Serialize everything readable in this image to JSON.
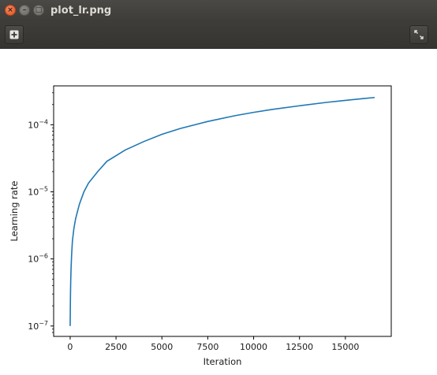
{
  "window": {
    "title": "plot_lr.png",
    "buttons": {
      "close": "×",
      "minimize": "–",
      "maximize": "□"
    }
  },
  "toolbar": {
    "left_icon": "add-icon",
    "right_icon": "fullscreen-icon"
  },
  "chart_data": {
    "type": "line",
    "xlabel": "Iteration",
    "ylabel": "Learning rate",
    "yscale": "log",
    "xlim": [
      -900,
      17500
    ],
    "ylim": [
      7e-08,
      0.00038
    ],
    "x_ticks": [
      {
        "value": 0,
        "label": "0"
      },
      {
        "value": 2500,
        "label": "2500"
      },
      {
        "value": 5000,
        "label": "5000"
      },
      {
        "value": 7500,
        "label": "7500"
      },
      {
        "value": 10000,
        "label": "10000"
      },
      {
        "value": 12500,
        "label": "12500"
      },
      {
        "value": 15000,
        "label": "15000"
      }
    ],
    "y_ticks": [
      {
        "value": 1e-07,
        "base": "10",
        "exp": "−7"
      },
      {
        "value": 1e-06,
        "base": "10",
        "exp": "−6"
      },
      {
        "value": 1e-05,
        "base": "10",
        "exp": "−5"
      },
      {
        "value": 0.0001,
        "base": "10",
        "exp": "−4"
      }
    ],
    "series": [
      {
        "color": "#1f77b4",
        "x": [
          0,
          5,
          15,
          30,
          50,
          80,
          120,
          200,
          300,
          500,
          750,
          1000,
          1500,
          2000,
          3000,
          4000,
          5000,
          6000,
          7500,
          9000,
          10000,
          11000,
          12500,
          14000,
          15000,
          16000,
          16600
        ],
        "y": [
          1e-07,
          1.4e-07,
          2.6e-07,
          4.6e-07,
          7.3e-07,
          1.15e-06,
          1.8e-06,
          2.8e-06,
          4e-06,
          6.5e-06,
          1e-05,
          1.35e-05,
          2e-05,
          2.85e-05,
          4.2e-05,
          5.6e-05,
          7.2e-05,
          8.8e-05,
          0.000112,
          0.000137,
          0.000153,
          0.000169,
          0.000192,
          0.000216,
          0.000231,
          0.000246,
          0.000255
        ]
      }
    ],
    "grid": false
  }
}
